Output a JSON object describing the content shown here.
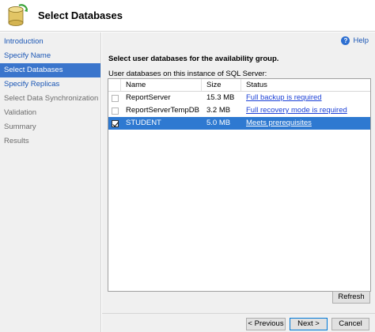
{
  "header": {
    "title": "Select Databases"
  },
  "sidebar": {
    "items": [
      {
        "label": "Introduction",
        "state": "link"
      },
      {
        "label": "Specify Name",
        "state": "link"
      },
      {
        "label": "Select Databases",
        "state": "selected"
      },
      {
        "label": "Specify Replicas",
        "state": "link"
      },
      {
        "label": "Select Data Synchronization",
        "state": "disabled"
      },
      {
        "label": "Validation",
        "state": "disabled"
      },
      {
        "label": "Summary",
        "state": "disabled"
      },
      {
        "label": "Results",
        "state": "disabled"
      }
    ]
  },
  "main": {
    "help_label": "Help",
    "instruction": "Select user databases for the availability group.",
    "grid_label": "User databases on this instance of SQL Server:",
    "columns": [
      "Name",
      "Size",
      "Status"
    ],
    "rows": [
      {
        "name": "ReportServer",
        "size": "15.3 MB",
        "status": "Full backup is required",
        "checked": false,
        "selected": false
      },
      {
        "name": "ReportServerTempDB",
        "size": "3.2 MB",
        "status": "Full recovery mode is required",
        "checked": false,
        "selected": false
      },
      {
        "name": "STUDENT",
        "size": "5.0 MB",
        "status": "Meets prerequisites",
        "checked": true,
        "selected": true
      }
    ],
    "refresh_label": "Refresh"
  },
  "footer": {
    "previous_label": "< Previous",
    "next_label": "Next >",
    "cancel_label": "Cancel"
  },
  "colors": {
    "selection": "#2e79d1",
    "link": "#1a56b5",
    "sidebar_bg": "#f0f0f0"
  }
}
